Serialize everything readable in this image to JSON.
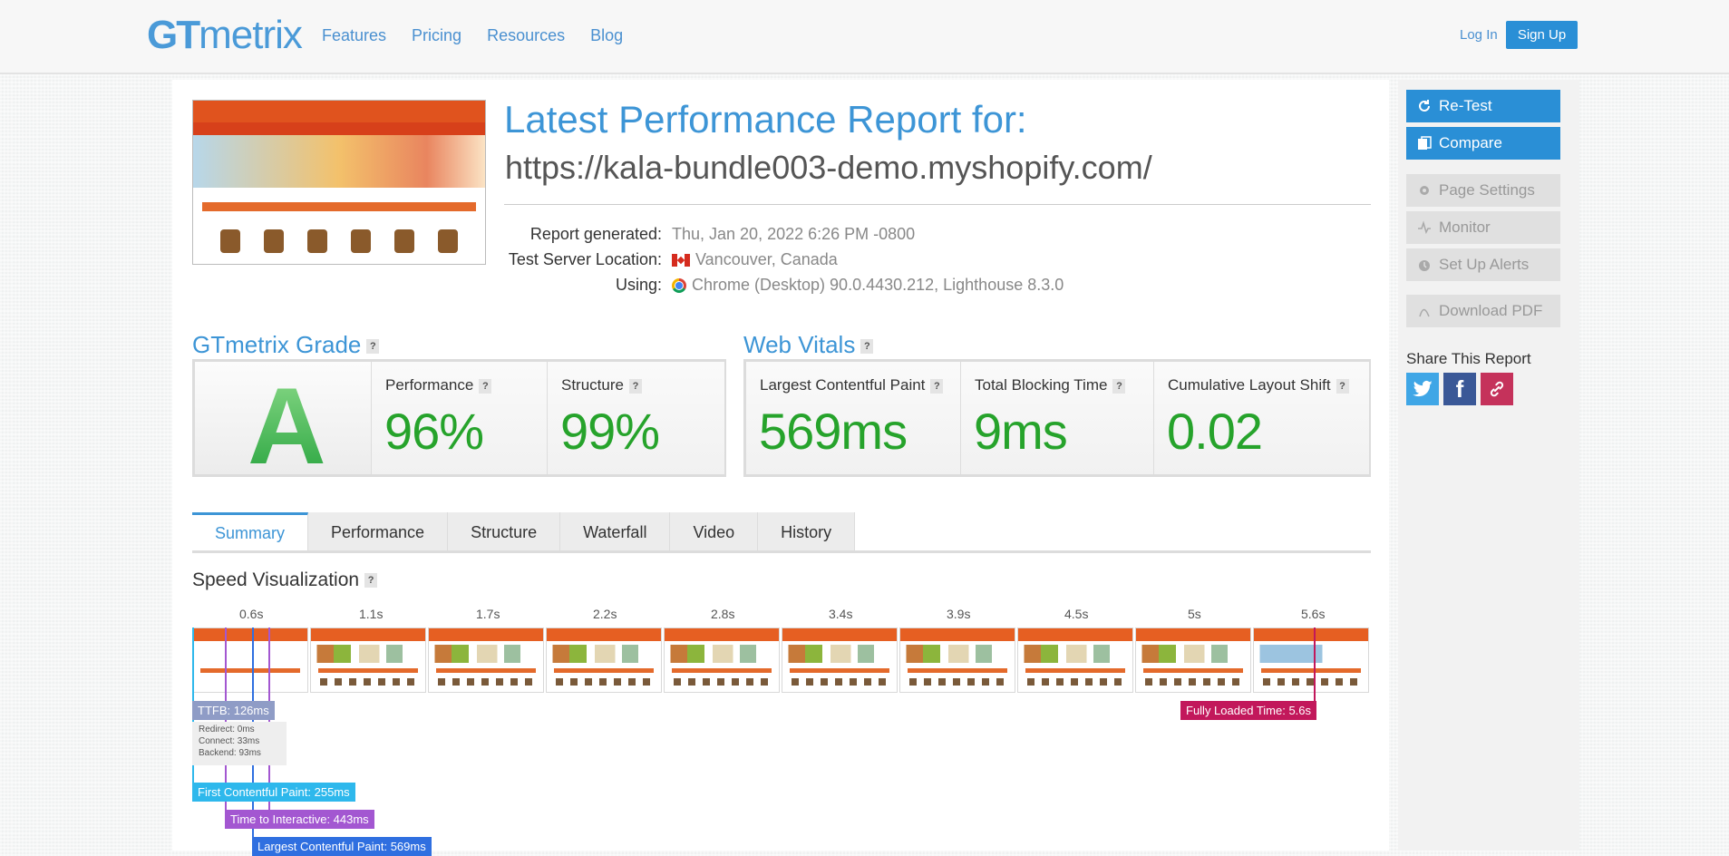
{
  "header": {
    "logo_gt": "GT",
    "logo_metrix": "metrix",
    "nav": [
      "Features",
      "Pricing",
      "Resources",
      "Blog"
    ],
    "login": "Log In",
    "signup": "Sign Up"
  },
  "report": {
    "title": "Latest Performance Report for:",
    "url": "https://kala-bundle003-demo.myshopify.com/",
    "meta": [
      {
        "label": "Report generated:",
        "value": "Thu, Jan 20, 2022 6:26 PM -0800"
      },
      {
        "label": "Test Server Location:",
        "value": "Vancouver, Canada"
      },
      {
        "label": "Using:",
        "value": "Chrome (Desktop) 90.0.4430.212, Lighthouse 8.3.0"
      }
    ]
  },
  "grade": {
    "title": "GTmetrix Grade",
    "letter": "A",
    "performance_label": "Performance",
    "performance_value": "96%",
    "structure_label": "Structure",
    "structure_value": "99%"
  },
  "vitals": {
    "title": "Web Vitals",
    "lcp_label": "Largest Contentful Paint",
    "lcp_value": "569ms",
    "tbt_label": "Total Blocking Time",
    "tbt_value": "9ms",
    "cls_label": "Cumulative Layout Shift",
    "cls_value": "0.02"
  },
  "tabs": [
    "Summary",
    "Performance",
    "Structure",
    "Waterfall",
    "Video",
    "History"
  ],
  "speed": {
    "title": "Speed Visualization",
    "ticks": [
      "0.6s",
      "1.1s",
      "1.7s",
      "2.2s",
      "2.8s",
      "3.4s",
      "3.9s",
      "4.5s",
      "5s",
      "5.6s"
    ],
    "ttfb": "TTFB: 126ms",
    "ttfb_detail": [
      "Redirect: 0ms",
      "Connect: 33ms",
      "Backend: 93ms"
    ],
    "fcp": "First Contentful Paint: 255ms",
    "tti": "Time to Interactive: 443ms",
    "lcp": "Largest Contentful Paint: 569ms",
    "fully_loaded": "Fully Loaded Time: 5.6s"
  },
  "sidebar": {
    "retest": "Re-Test",
    "compare": "Compare",
    "page_settings": "Page Settings",
    "monitor": "Monitor",
    "alerts": "Set Up Alerts",
    "download": "Download PDF",
    "share_title": "Share This Report"
  },
  "colors": {
    "brand_blue": "#3d95d6",
    "grade_green": "#26a32b",
    "ttfb": "#8f9cc6",
    "fcp": "#2eb8ec",
    "tti": "#a357d1",
    "lcp": "#2f6fe0",
    "fully_loaded": "#c2185b"
  }
}
